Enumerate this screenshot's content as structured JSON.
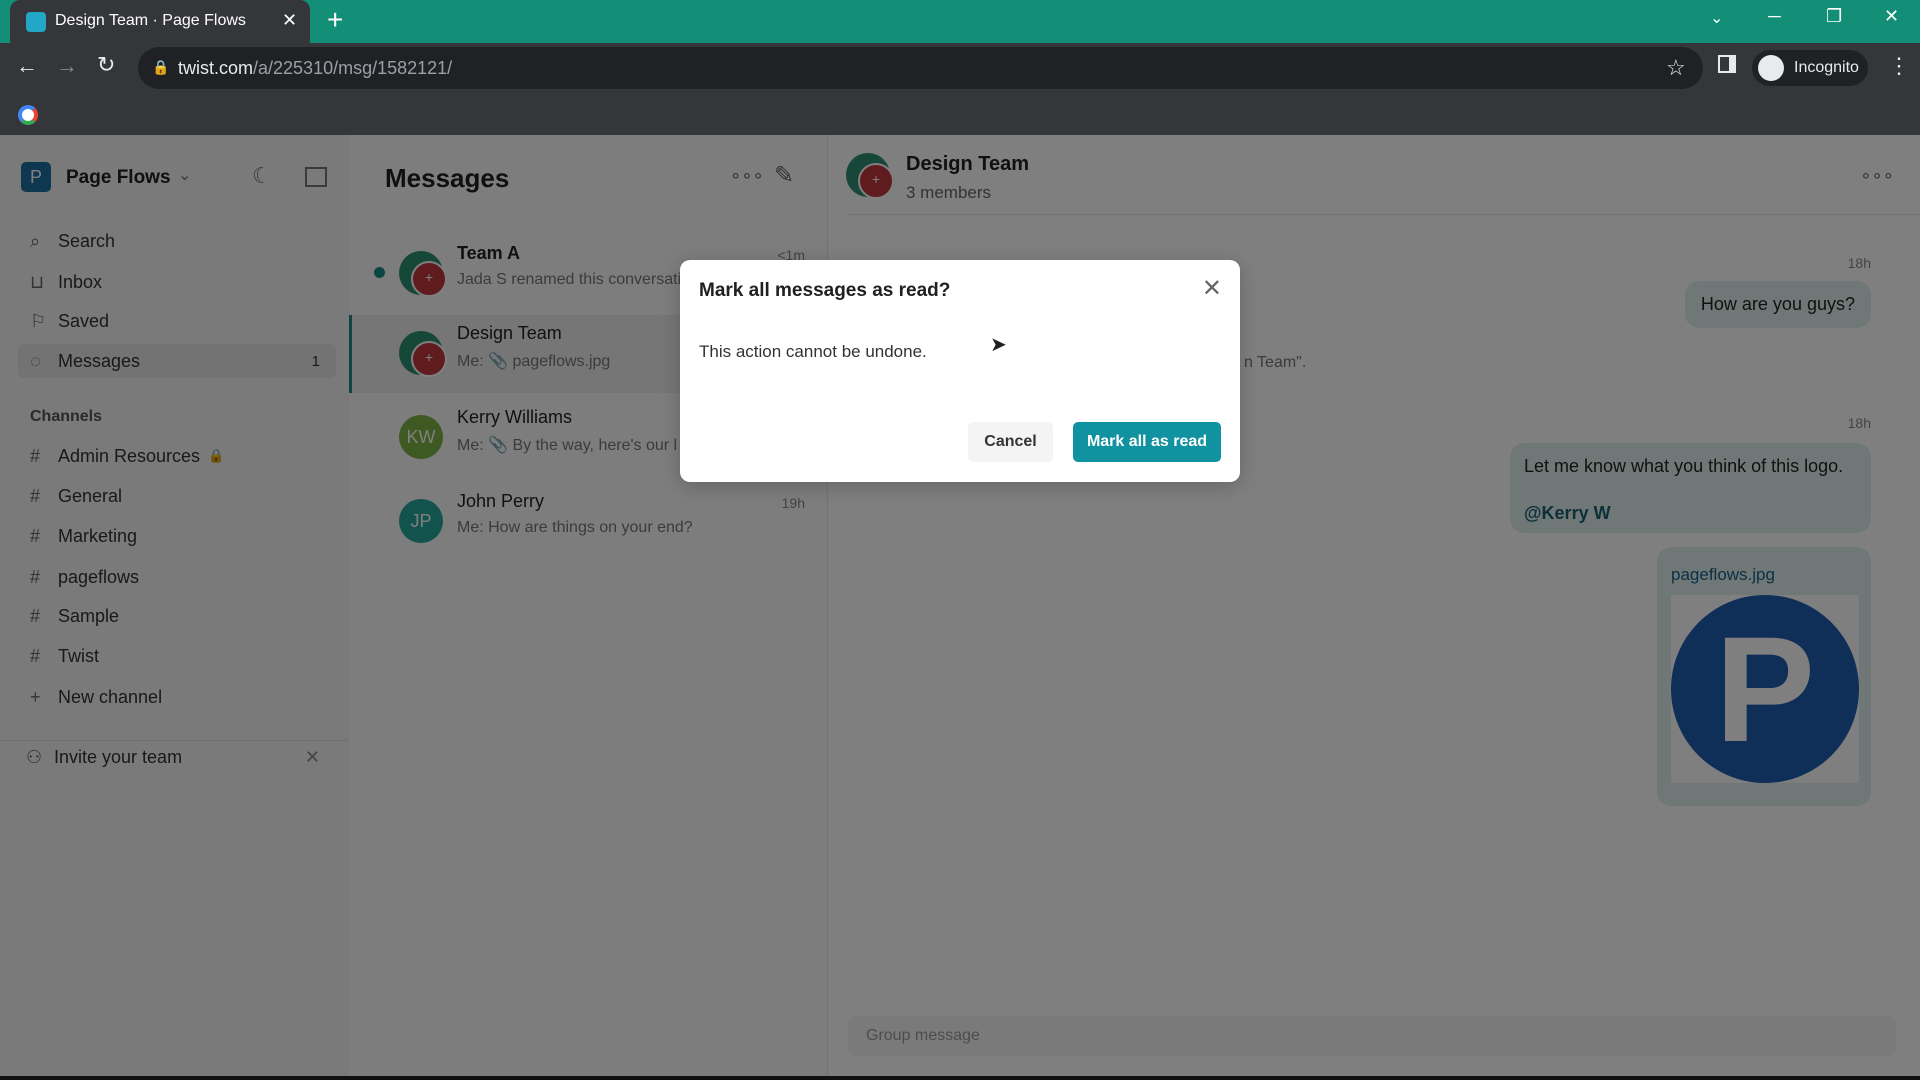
{
  "browser": {
    "tab_title": "Design Team · Page Flows",
    "url_domain": "twist.com",
    "url_path": "/a/225310/msg/1582121/",
    "profile": "Incognito"
  },
  "sidebar": {
    "workspace": "Page Flows",
    "workspace_initial": "P",
    "nav": [
      {
        "label": "Search",
        "icon": "search-icon"
      },
      {
        "label": "Inbox",
        "icon": "inbox-icon"
      },
      {
        "label": "Saved",
        "icon": "bookmark-icon"
      },
      {
        "label": "Messages",
        "icon": "chat-icon",
        "badge": "1"
      }
    ],
    "channels_heading": "Channels",
    "channels": [
      {
        "label": "Admin Resources",
        "locked": true
      },
      {
        "label": "General"
      },
      {
        "label": "Marketing"
      },
      {
        "label": "pageflows"
      },
      {
        "label": "Sample"
      },
      {
        "label": "Twist"
      }
    ],
    "new_channel": "New channel",
    "invite": "Invite your team"
  },
  "messages": {
    "title": "Messages",
    "items": [
      {
        "name": "Team A",
        "preview": "Jada S renamed this conversati",
        "time": "<1m",
        "unread": true
      },
      {
        "name": "Design Team",
        "preview": "Me: 📎 pageflows.jpg",
        "time": "",
        "selected": true
      },
      {
        "name": "Kerry Williams",
        "initials": "KW",
        "preview": "Me: 📎 By the way, here's our l",
        "time": ""
      },
      {
        "name": "John Perry",
        "initials": "JP",
        "preview": "Me: How are things on your end?",
        "time": "19h"
      }
    ]
  },
  "chat": {
    "title": "Design Team",
    "subtitle": "3 members",
    "time1": "18h",
    "msg1": "How are you guys?",
    "system_fragment": "n Team\".",
    "time2": "18h",
    "msg2": "Let me know what you think of this logo.",
    "mention": "@Kerry W",
    "attachment": "pageflows.jpg",
    "attachment_letter": "P",
    "composer_placeholder": "Group message"
  },
  "modal": {
    "title": "Mark all messages as read?",
    "body": "This action cannot be undone.",
    "cancel": "Cancel",
    "confirm": "Mark all as read"
  },
  "colors": {
    "accent": "#1192a0",
    "browser_frame": "#128f76"
  }
}
